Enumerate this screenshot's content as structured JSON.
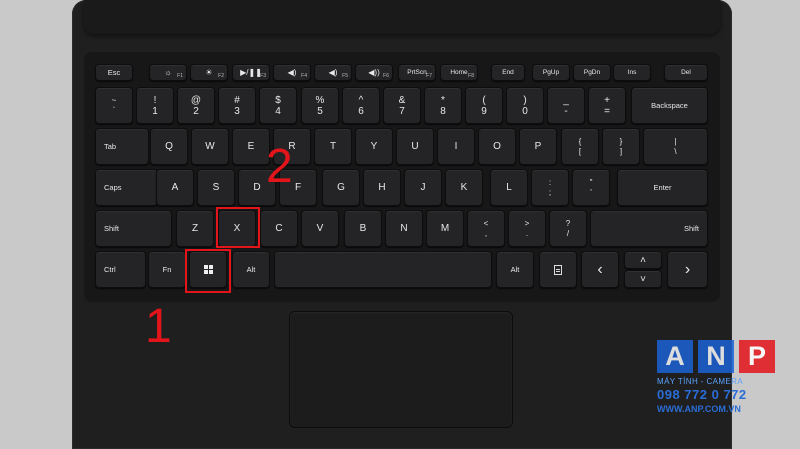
{
  "keys": {
    "esc": "Esc",
    "f1": "F1",
    "f2": "F2",
    "f3": "F3",
    "f4": "F4",
    "f5": "F5",
    "f6": "F6",
    "f7": "F7",
    "f8": "F8",
    "f1_sym": "☼",
    "f2_sym": "☀",
    "f3_sym": "▶/❚❚",
    "f4_sym": "◀)",
    "f5_sym": "◀)",
    "f6_sym": "◀))",
    "f7_sym": "◀)))",
    "prtscn": "PrtScn",
    "home": "Home",
    "end": "End",
    "pgup": "PgUp",
    "pgdn": "PgDn",
    "ins": "Ins",
    "del": "Del",
    "tilde_top": "~",
    "tilde_bot": "`",
    "n1_top": "!",
    "n1": "1",
    "n2_top": "@",
    "n2": "2",
    "n3_top": "#",
    "n3": "3",
    "n4_top": "$",
    "n4": "4",
    "n5_top": "%",
    "n5": "5",
    "n6_top": "^",
    "n6": "6",
    "n7_top": "&",
    "n7": "7",
    "n8_top": "*",
    "n8": "8",
    "n9_top": "(",
    "n9": "9",
    "n0_top": ")",
    "n0": "0",
    "minus_top": "_",
    "minus": "-",
    "eq_top": "+",
    "eq": "=",
    "backspace": "Backspace",
    "tab": "Tab",
    "q": "Q",
    "w": "W",
    "e": "E",
    "r": "R",
    "t": "T",
    "y": "Y",
    "u": "U",
    "i": "I",
    "o": "O",
    "p": "P",
    "lbr_top": "{",
    "lbr": "[",
    "rbr_top": "}",
    "rbr": "]",
    "bsl_top": "|",
    "bsl": "\\",
    "caps": "Caps",
    "a": "A",
    "s": "S",
    "d": "D",
    "f": "F",
    "g": "G",
    "h": "H",
    "j": "J",
    "k": "K",
    "l": "L",
    "semi_top": ":",
    "semi": ";",
    "quote_top": "\"",
    "quote": "'",
    "enter": "Enter",
    "shift": "Shift",
    "z": "Z",
    "x": "X",
    "c": "C",
    "v": "V",
    "b": "B",
    "n": "N",
    "m": "M",
    "comma_top": "<",
    "comma": ",",
    "period_top": ">",
    "period": ".",
    "slash_top": "?",
    "slash": "/",
    "ctrl": "Ctrl",
    "fn": "Fn",
    "alt": "Alt",
    "arrow_left": "‹",
    "arrow_up": "˄",
    "arrow_down": "˅",
    "arrow_right": "›"
  },
  "annotations": {
    "step1": "1",
    "step2": "2"
  },
  "watermark": {
    "letters": [
      "A",
      "N",
      "P"
    ],
    "colors": [
      "#1b63d6",
      "#1b63d6",
      "#e4141b"
    ],
    "tagline": "MÁY TÍNH - CAMERA",
    "phone": "098 772 0 772",
    "url": "WWW.ANP.COM.VN"
  }
}
